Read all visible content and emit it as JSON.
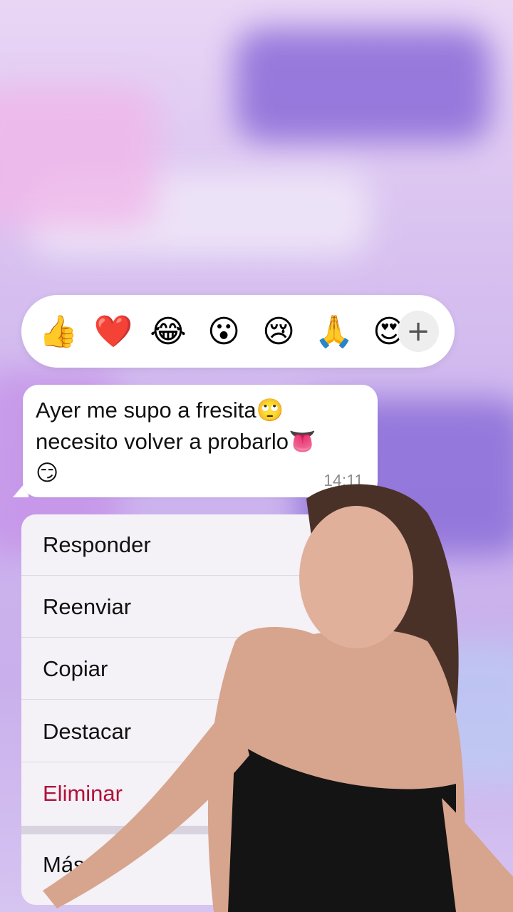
{
  "reactions": {
    "items": [
      {
        "emoji": "👍",
        "name": "thumbs-up"
      },
      {
        "emoji": "❤️",
        "name": "heart"
      },
      {
        "emoji": "😂",
        "name": "laughing"
      },
      {
        "emoji": "😮",
        "name": "surprised"
      },
      {
        "emoji": "😢",
        "name": "crying"
      },
      {
        "emoji": "🙏",
        "name": "pray"
      },
      {
        "emoji": "😍",
        "name": "heart-eyes"
      }
    ],
    "more": "+"
  },
  "message": {
    "text": "Ayer me supo a fresita🙄\nnecesito volver a probarlo👅\n😏",
    "time": "14:11"
  },
  "menu": {
    "items": [
      {
        "label": "Responder"
      },
      {
        "label": "Reenviar"
      },
      {
        "label": "Copiar"
      },
      {
        "label": "Destacar"
      },
      {
        "label": "Eliminar",
        "destructive": true
      },
      {
        "label": "Más..."
      }
    ]
  },
  "colors": {
    "destructive": "#b0123a",
    "bubble": "#ffffff",
    "menu_bg": "#f4f1f7"
  }
}
